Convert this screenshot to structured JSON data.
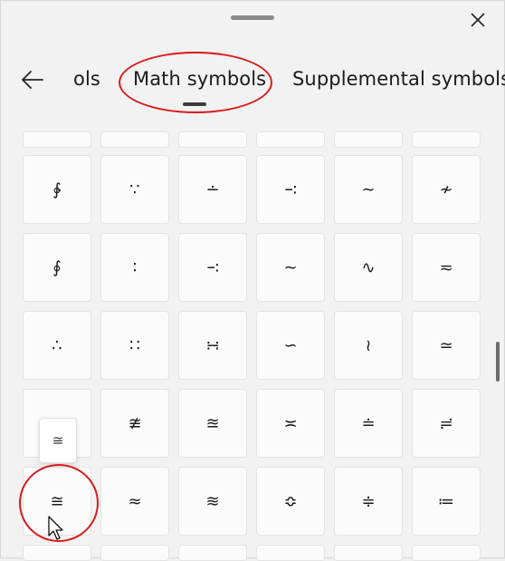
{
  "header": {
    "tabs": [
      {
        "label": "ols"
      },
      {
        "label": "Math symbols",
        "active": true
      },
      {
        "label": "Supplemental symbols"
      }
    ]
  },
  "icons": {
    "close": "close-icon",
    "back": "back-arrow-icon",
    "cursor": "mouse-pointer-icon"
  },
  "accent_color": "#d81b1b",
  "rows": [
    {
      "partial": true,
      "symbols": [
        "",
        "",
        "",
        "",
        "",
        ""
      ]
    },
    {
      "symbols": [
        "∲",
        "∵",
        "∸",
        "∹",
        "∼",
        "≁"
      ]
    },
    {
      "symbols": [
        "∮",
        "∶",
        "∹",
        "∼",
        "∿",
        "≂"
      ]
    },
    {
      "symbols": [
        "∴",
        "∷",
        "∺",
        "∽",
        "≀",
        "≃"
      ]
    },
    {
      "symbols": [
        "",
        "≇",
        "≊",
        "≍",
        "≐",
        "≓"
      ]
    },
    {
      "symbols": [
        "≅",
        "≈",
        "≋",
        "≎",
        "≑",
        "≔"
      ]
    },
    {
      "partial": true,
      "symbols": [
        "",
        "",
        "",
        "",
        "",
        ""
      ]
    }
  ],
  "tooltip": {
    "symbol": "≅"
  }
}
